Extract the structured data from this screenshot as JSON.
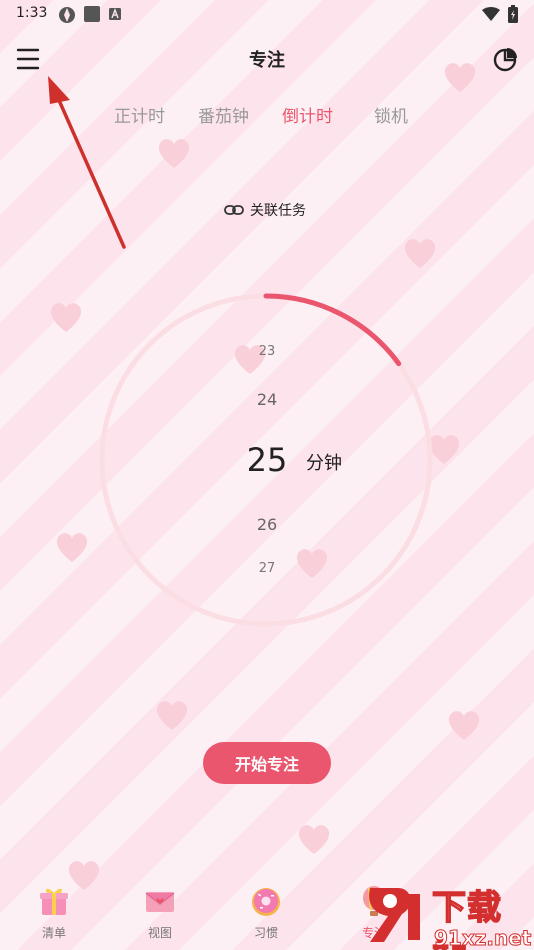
{
  "status_bar": {
    "time": "1:33"
  },
  "header": {
    "title": "专注"
  },
  "tabs": [
    {
      "label": "正计时",
      "active": false
    },
    {
      "label": "番茄钟",
      "active": false
    },
    {
      "label": "倒计时",
      "active": true
    },
    {
      "label": "锁机",
      "active": false
    }
  ],
  "link_task": {
    "label": "关联任务"
  },
  "timer": {
    "picker_values": [
      "23",
      "24",
      "25",
      "26",
      "27"
    ],
    "selected": "25",
    "unit": "分钟",
    "progress_fraction": 0.15
  },
  "start_button": {
    "label": "开始专注"
  },
  "bottom_nav": [
    {
      "label": "清单",
      "icon": "gift-icon"
    },
    {
      "label": "视图",
      "icon": "envelope-icon"
    },
    {
      "label": "习惯",
      "icon": "donut-icon"
    },
    {
      "label": "专注",
      "icon": "balloon-icon",
      "active": true
    }
  ],
  "watermark": {
    "title": "下载站",
    "url": "91xz.net"
  },
  "colors": {
    "accent": "#e9566e",
    "ring": "#fbdde4",
    "background": "#fde4ec"
  }
}
